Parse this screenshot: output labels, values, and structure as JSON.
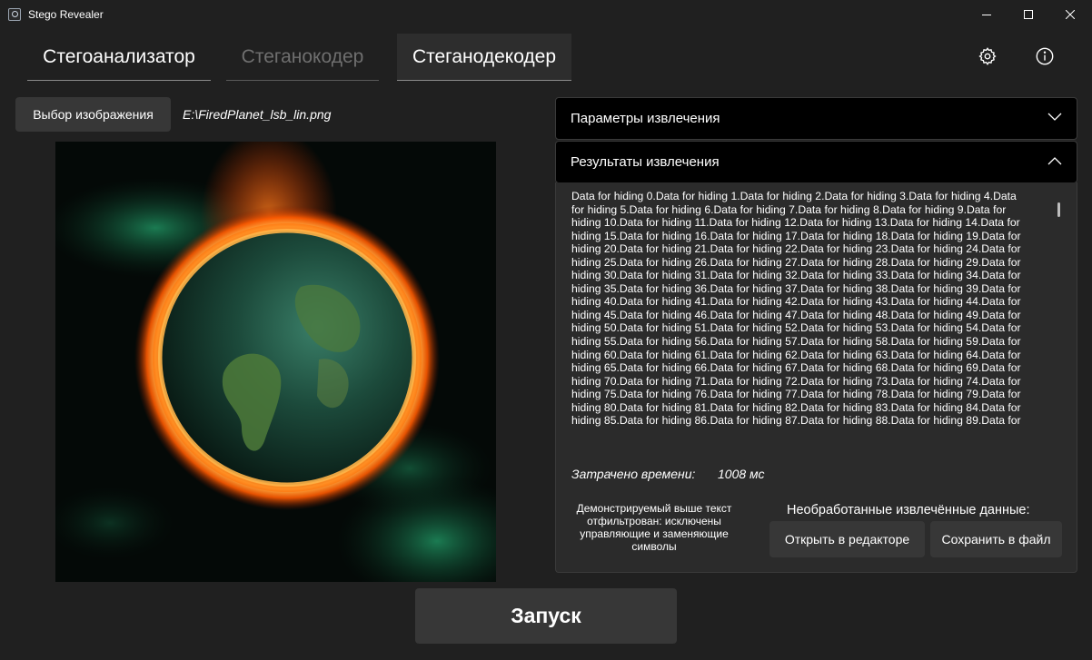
{
  "window": {
    "title": "Stego Revealer",
    "controls": [
      "minimize-icon",
      "maximize-icon",
      "close-icon"
    ]
  },
  "tabs": [
    {
      "label": "Стегоанализатор",
      "state": "normal"
    },
    {
      "label": "Стеганокодер",
      "state": "disabled"
    },
    {
      "label": "Стеганодекодер",
      "state": "selected"
    }
  ],
  "header_icons": [
    "gear-icon",
    "info-icon"
  ],
  "image_select": {
    "button_label": "Выбор изображения",
    "file_path": "E:\\FiredPlanet_lsb_lin.png"
  },
  "params_panel": {
    "title": "Параметры извлечения",
    "expanded": false
  },
  "results_panel": {
    "title": "Результаты извлечения",
    "expanded": true,
    "text_lines": [
      "Data for hiding 0.Data for hiding 1.Data for hiding 2.Data for hiding 3.Data for hiding 4.Data",
      "for hiding 5.Data for hiding 6.Data for hiding 7.Data for hiding 8.Data for hiding 9.Data for",
      "hiding 10.Data for hiding 11.Data for hiding 12.Data for hiding 13.Data for hiding 14.Data for",
      "hiding 15.Data for hiding 16.Data for hiding 17.Data for hiding 18.Data for hiding 19.Data for",
      "hiding 20.Data for hiding 21.Data for hiding 22.Data for hiding 23.Data for hiding 24.Data for",
      "hiding 25.Data for hiding 26.Data for hiding 27.Data for hiding 28.Data for hiding 29.Data for",
      "hiding 30.Data for hiding 31.Data for hiding 32.Data for hiding 33.Data for hiding 34.Data for",
      "hiding 35.Data for hiding 36.Data for hiding 37.Data for hiding 38.Data for hiding 39.Data for",
      "hiding 40.Data for hiding 41.Data for hiding 42.Data for hiding 43.Data for hiding 44.Data for",
      "hiding 45.Data for hiding 46.Data for hiding 47.Data for hiding 48.Data for hiding 49.Data for",
      "hiding 50.Data for hiding 51.Data for hiding 52.Data for hiding 53.Data for hiding 54.Data for",
      "hiding 55.Data for hiding 56.Data for hiding 57.Data for hiding 58.Data for hiding 59.Data for",
      "hiding 60.Data for hiding 61.Data for hiding 62.Data for hiding 63.Data for hiding 64.Data for",
      "hiding 65.Data for hiding 66.Data for hiding 67.Data for hiding 68.Data for hiding 69.Data for",
      "hiding 70.Data for hiding 71.Data for hiding 72.Data for hiding 73.Data for hiding 74.Data for",
      "hiding 75.Data for hiding 76.Data for hiding 77.Data for hiding 78.Data for hiding 79.Data for",
      "hiding 80.Data for hiding 81.Data for hiding 82.Data for hiding 83.Data for hiding 84.Data for",
      "hiding 85.Data for hiding 86.Data for hiding 87.Data for hiding 88.Data for hiding 89.Data for"
    ],
    "time_label": "Затрачено времени:",
    "time_value": "1008 мс",
    "filter_note": "Демонстрируемый выше текст отфильтрован: исключены управляющие и заменяющие символы",
    "raw_data_label": "Необработанные извлечённые данные:",
    "open_editor_label": "Открыть в редакторе",
    "save_file_label": "Сохранить в файл"
  },
  "run_button_label": "Запуск"
}
